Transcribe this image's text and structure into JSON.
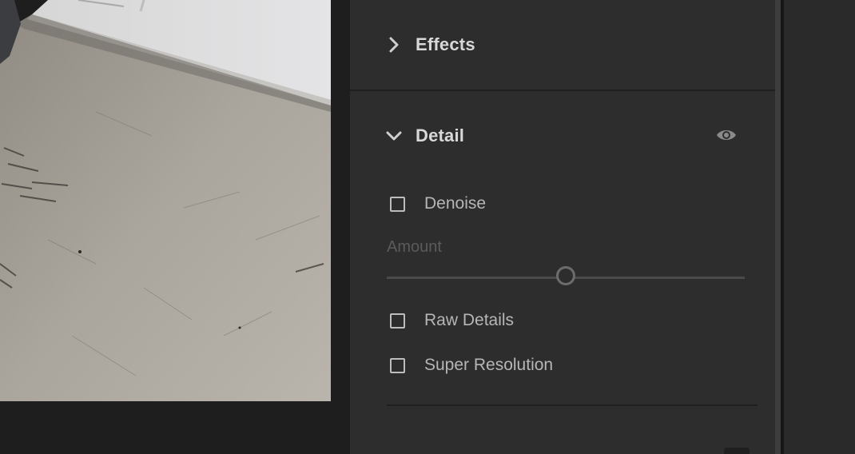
{
  "panel": {
    "sections": [
      {
        "title": "Effects",
        "expanded": false,
        "chevron": "chevron-right-icon"
      },
      {
        "title": "Detail",
        "expanded": true,
        "chevron": "chevron-down-icon",
        "visibility_icon": "eye-icon"
      }
    ],
    "detail": {
      "denoise_label": "Denoise",
      "denoise_checked": false,
      "amount_label": "Amount",
      "amount_disabled": true,
      "amount_value_fraction": 0.5,
      "raw_details_label": "Raw Details",
      "raw_details_checked": false,
      "super_resolution_label": "Super Resolution",
      "super_resolution_checked": false
    }
  },
  "colors": {
    "panel_bg": "#2d2d2d",
    "app_bg": "#1c1c1c",
    "text_heading": "#d8d8d8",
    "text_label": "#b6b6b6",
    "text_disabled": "#5b5b5b"
  }
}
